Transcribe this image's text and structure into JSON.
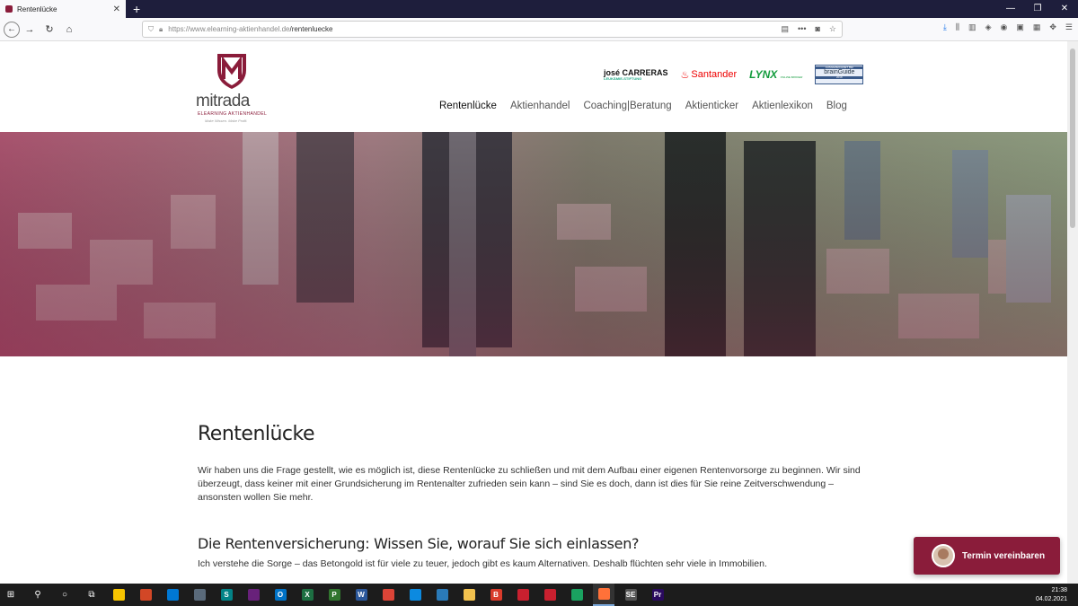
{
  "browser": {
    "tab_title": "Rentenlücke",
    "url_host": "https://www.elearning-aktienhandel.de",
    "url_path": "/rentenluecke",
    "new_tab": "+",
    "close_tab": "✕"
  },
  "site": {
    "brand": "mitrada",
    "brand_sub": "ELEARNING AKTIENHANDEL",
    "brand_tagline": "Make Wissen. Make Profit.",
    "partners": {
      "jose": "josé CARRERAS",
      "jose_sub": "LEUKÄMIE-STIFTUNG",
      "santander": "Santander",
      "lynx": "LYNX",
      "lynx_sub": "ONLINE BROKER",
      "brainguide_top": "AUSGEZEICHNET BEI",
      "brainguide": "brainGuide",
      "brainguide_year": "2018"
    },
    "nav": [
      "Rentenlücke",
      "Aktienhandel",
      "Coaching|Beratung",
      "Aktienticker",
      "Aktienlexikon",
      "Blog"
    ]
  },
  "content": {
    "title": "Rentenlücke",
    "intro": "Wir haben uns die Frage gestellt, wie es möglich ist, diese Rentenlücke zu schließen und mit dem Aufbau einer eigenen Rentenvorsorge zu beginnen. Wir sind überzeugt, dass keiner mit einer Grundsicherung im Rentenalter zufrieden sein kann – sind Sie es doch, dann ist dies für Sie reine Zeitverschwendung – ansonsten wollen Sie mehr.",
    "section_title": "Die Rentenversicherung: Wissen Sie, worauf Sie sich einlassen?",
    "section_text": "Ich verstehe die Sorge – das Betongold ist für viele zu teuer, jedoch gibt es kaum Alternativen. Deshalb flüchten sehr viele in Immobilien."
  },
  "cta": {
    "label": "Termin vereinbaren"
  },
  "taskbar": {
    "time": "21:38",
    "date": "04.02.2021",
    "apps": [
      {
        "name": "sticky-notes",
        "glyph": "",
        "color": "#f7c400"
      },
      {
        "name": "store",
        "glyph": "",
        "color": "#d24726"
      },
      {
        "name": "mail",
        "glyph": "",
        "color": "#0078d4"
      },
      {
        "name": "calculator",
        "glyph": "",
        "color": "#5a6a7a"
      },
      {
        "name": "sharepoint",
        "glyph": "S",
        "color": "#038387"
      },
      {
        "name": "visual-studio",
        "glyph": "",
        "color": "#68217a"
      },
      {
        "name": "outlook",
        "glyph": "O",
        "color": "#0072c6"
      },
      {
        "name": "excel",
        "glyph": "X",
        "color": "#1d6f42"
      },
      {
        "name": "project",
        "glyph": "P",
        "color": "#31752f"
      },
      {
        "name": "word",
        "glyph": "W",
        "color": "#2b579a"
      },
      {
        "name": "chrome",
        "glyph": "",
        "color": "#db4437"
      },
      {
        "name": "edge",
        "glyph": "",
        "color": "#0c8ae0"
      },
      {
        "name": "generic-app",
        "glyph": "",
        "color": "#2a7ab8"
      },
      {
        "name": "file-explorer",
        "glyph": "",
        "color": "#f2c14e"
      },
      {
        "name": "brave-app",
        "glyph": "B",
        "color": "#d93b2b"
      },
      {
        "name": "red-app",
        "glyph": "",
        "color": "#c8202f"
      },
      {
        "name": "red-app-2",
        "glyph": "",
        "color": "#c8202f"
      },
      {
        "name": "stocks-app",
        "glyph": "",
        "color": "#1aa260"
      },
      {
        "name": "firefox",
        "glyph": "",
        "color": "#ff7139"
      },
      {
        "name": "se-app",
        "glyph": "SE",
        "color": "#555"
      },
      {
        "name": "premiere",
        "glyph": "Pr",
        "color": "#2a0a5e"
      }
    ]
  },
  "colors": {
    "brand": "#8a1c3a",
    "taskbar": "#1c1c1c"
  }
}
